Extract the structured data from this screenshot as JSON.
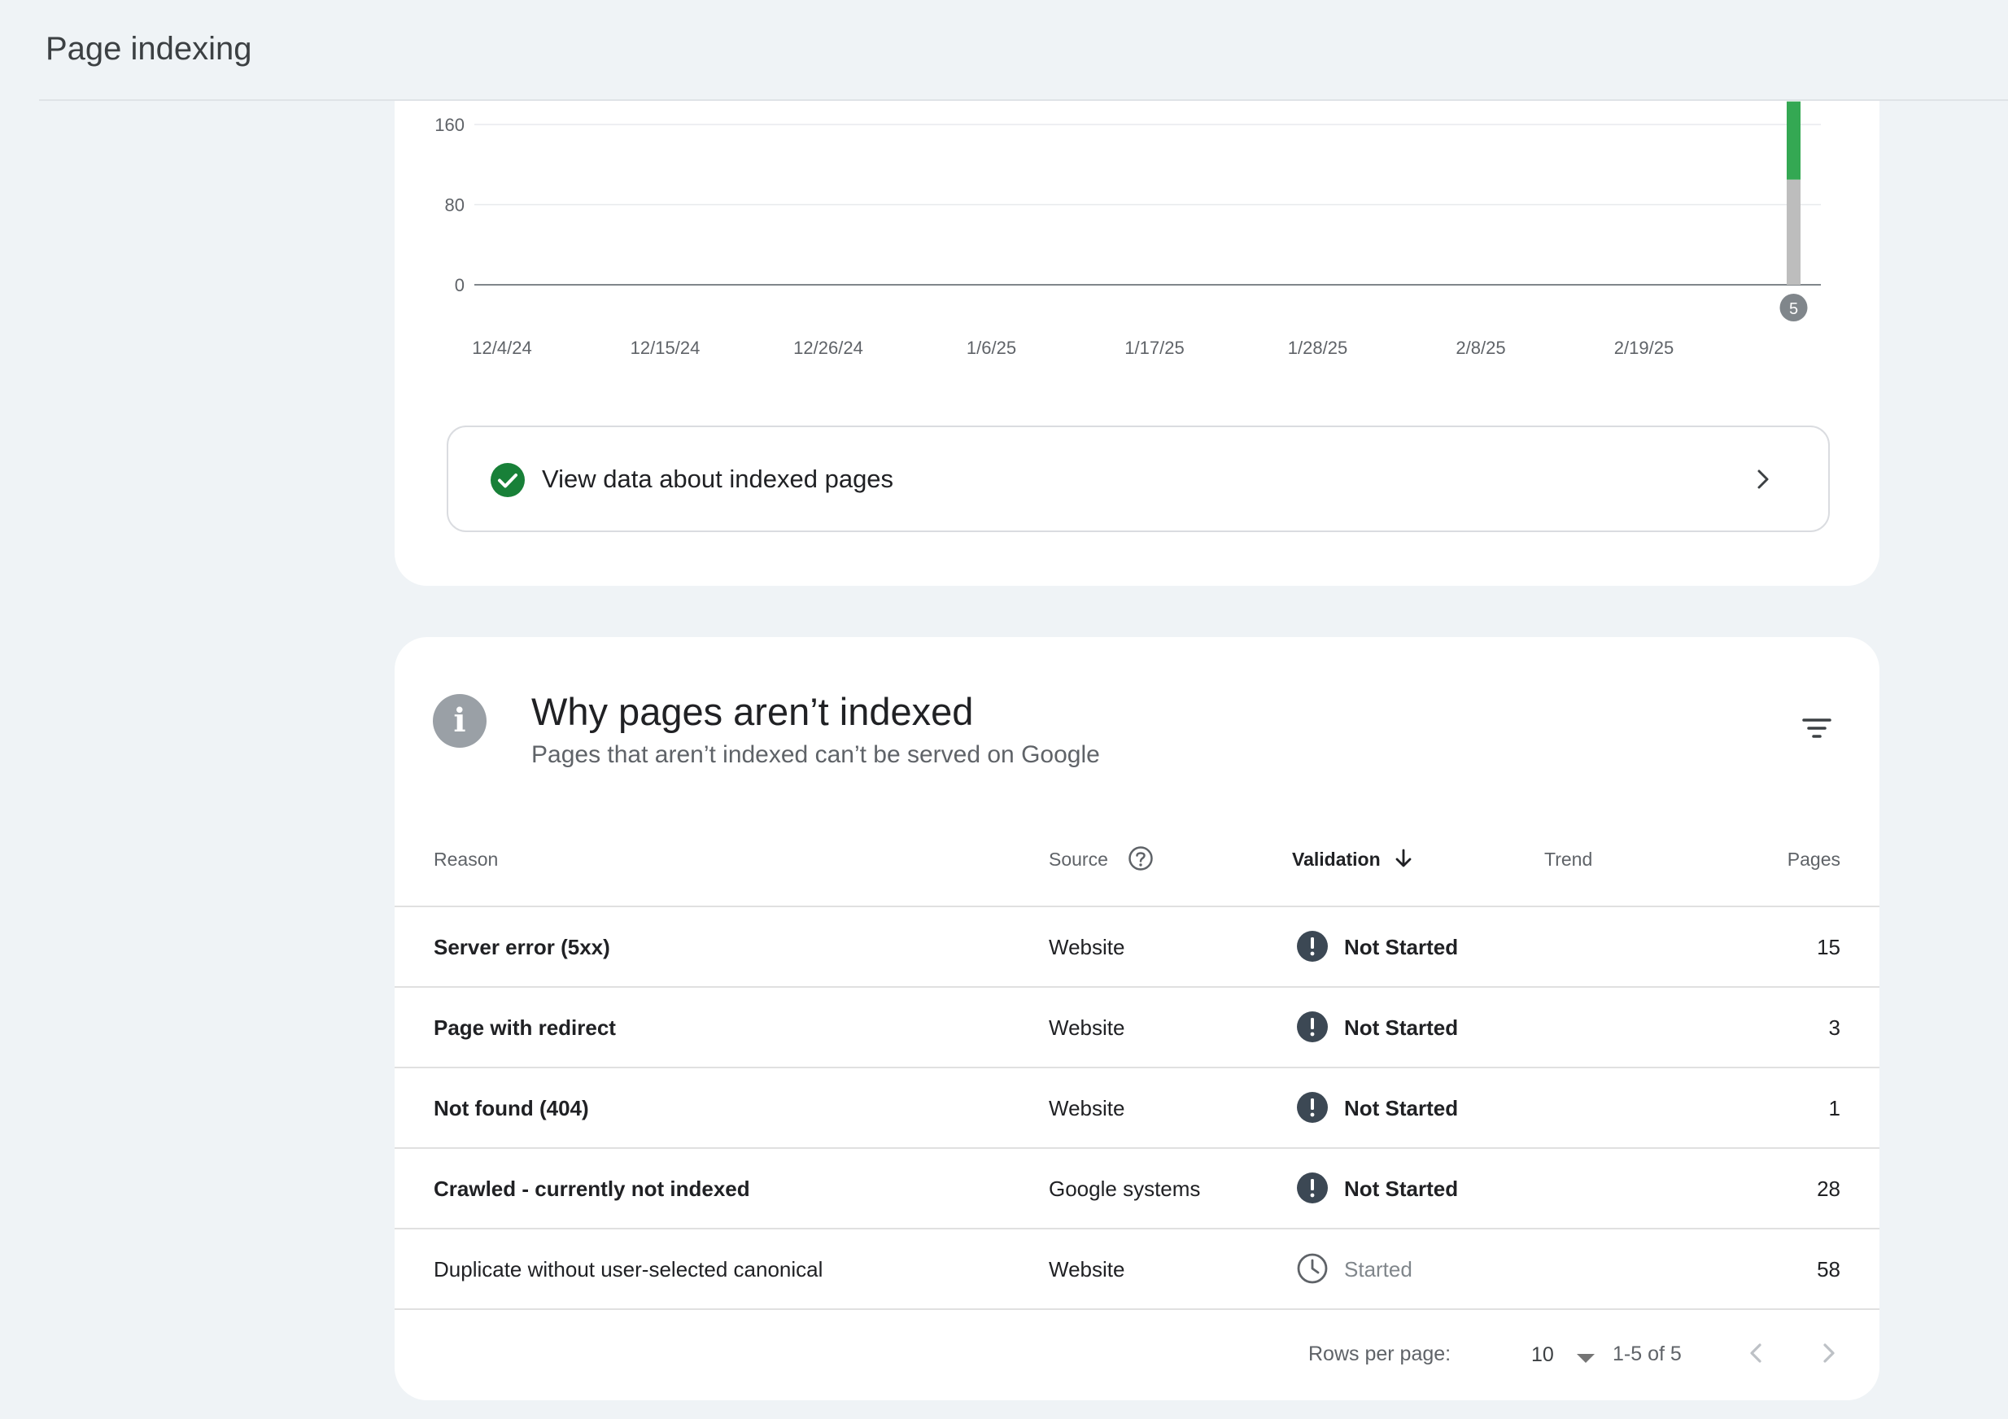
{
  "header": {
    "title": "Page indexing"
  },
  "chart_data": {
    "type": "bar",
    "stacked": true,
    "yticks": [
      "0",
      "80",
      "160"
    ],
    "xticks": [
      "12/4/24",
      "12/15/24",
      "12/26/24",
      "1/6/25",
      "1/17/25",
      "1/28/25",
      "2/8/25",
      "2/19/25"
    ],
    "series": [
      {
        "name": "",
        "color": "#bdbdbd",
        "values": [
          {
            "x": "3/3/25",
            "y": 105
          }
        ]
      },
      {
        "name": "",
        "color": "#34a853",
        "values": [
          {
            "x": "3/3/25",
            "y": 78
          }
        ]
      }
    ],
    "annotation": {
      "x": "3/3/25",
      "label": "5"
    },
    "grid": true
  },
  "indexed_link": {
    "label": "View data about indexed pages"
  },
  "issues": {
    "title": "Why pages aren’t indexed",
    "subtitle": "Pages that aren’t indexed can’t be served on Google",
    "columns": {
      "reason": "Reason",
      "source": "Source",
      "validation": "Validation",
      "trend": "Trend",
      "pages": "Pages"
    },
    "rows": [
      {
        "reason": "Server error (5xx)",
        "source": "Website",
        "validation": "Not Started",
        "status": "not-started",
        "pages": "15"
      },
      {
        "reason": "Page with redirect",
        "source": "Website",
        "validation": "Not Started",
        "status": "not-started",
        "pages": "3"
      },
      {
        "reason": "Not found (404)",
        "source": "Website",
        "validation": "Not Started",
        "status": "not-started",
        "pages": "1"
      },
      {
        "reason": "Crawled - currently not indexed",
        "source": "Google systems",
        "validation": "Not Started",
        "status": "not-started",
        "pages": "28"
      },
      {
        "reason": "Duplicate without user-selected canonical",
        "source": "Website",
        "validation": "Started",
        "status": "started",
        "pages": "58"
      }
    ],
    "footer": {
      "rows_per_page_label": "Rows per page:",
      "rows_per_page_value": "10",
      "range": "1-5 of 5"
    }
  },
  "colors": {
    "accent_green": "#188038",
    "status_dark": "#3c4854",
    "background": "#eff3f6"
  },
  "icons": {
    "check": "check-circle-icon",
    "info": "info-icon",
    "filter": "filter-icon",
    "help": "help-circle-icon",
    "sort": "arrow-down-icon",
    "alert": "alert-circle-icon",
    "clock": "clock-icon"
  }
}
